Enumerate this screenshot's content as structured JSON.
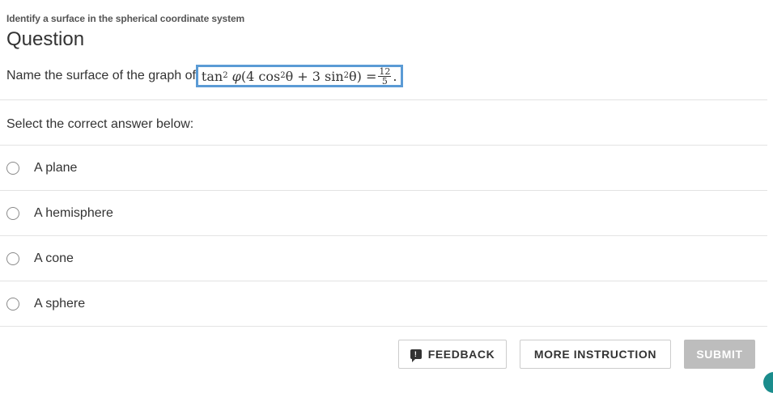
{
  "breadcrumb": "Identify a surface in the spherical coordinate system",
  "title": "Question",
  "prompt": {
    "text": "Name the surface of the graph of",
    "equation": {
      "lhs_fn": "tan",
      "lhs_power": "2",
      "lhs_var": "φ",
      "open": "(4 cos",
      "cos_power": "2",
      "theta1": " θ + 3 sin",
      "sin_power": "2",
      "theta2": " θ) =",
      "frac_num": "12",
      "frac_den": "5",
      "end": "."
    }
  },
  "instruction": "Select the correct answer below:",
  "options": [
    {
      "label": "A plane"
    },
    {
      "label": "A hemisphere"
    },
    {
      "label": "A cone"
    },
    {
      "label": "A sphere"
    }
  ],
  "buttons": {
    "feedback": "FEEDBACK",
    "more_instruction": "MORE INSTRUCTION",
    "submit": "SUBMIT"
  },
  "colors": {
    "highlight_border": "#5b9bd5",
    "submit_disabled": "#bdbdbd",
    "corner_accent": "#1a8c8c"
  }
}
